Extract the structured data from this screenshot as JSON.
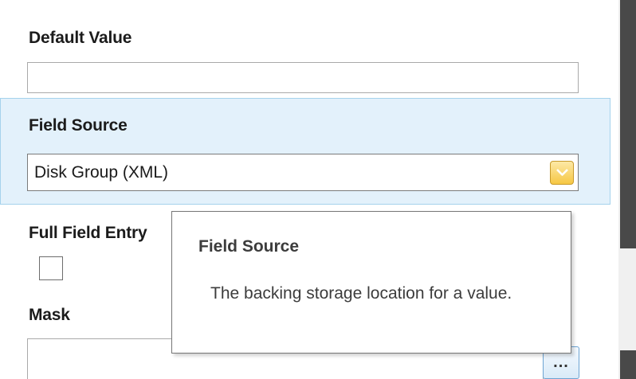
{
  "fields": {
    "default_value": {
      "label": "Default Value",
      "value": ""
    },
    "field_source": {
      "label": "Field Source",
      "selected": "Disk Group (XML)"
    },
    "full_field_entry": {
      "label": "Full Field Entry",
      "checked": false
    },
    "mask": {
      "label": "Mask",
      "value": "",
      "browse_label": "..."
    }
  },
  "tooltip": {
    "title": "Field Source",
    "body": "The backing storage location for a value."
  },
  "colors": {
    "highlight": "#e3f1fb",
    "highlight_border": "#a5d2ec",
    "dropdown_button": "#f6c744",
    "scrollbar": "#494949"
  },
  "icons": {
    "dropdown": "chevron-down-icon"
  }
}
